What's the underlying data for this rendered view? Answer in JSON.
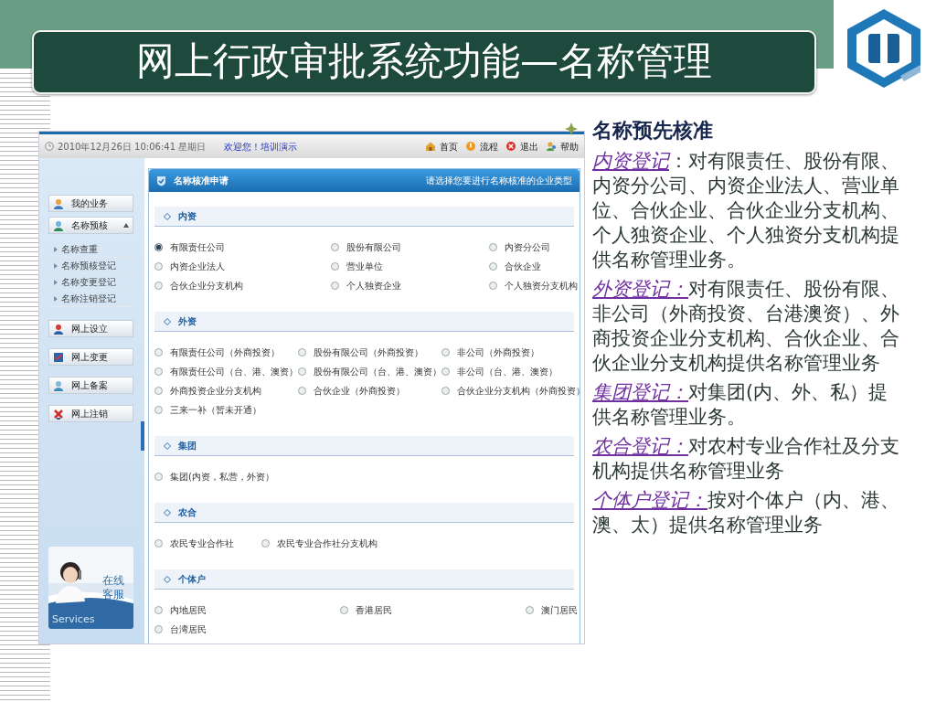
{
  "slide": {
    "title": "网上行政审批系统功能—名称管理"
  },
  "screenshot": {
    "top_bar": {
      "datetime": "2010年12月26日 10:06:41 星期日",
      "welcome": "欢迎您！培训演示",
      "links": [
        {
          "label": "首页"
        },
        {
          "label": "流程"
        },
        {
          "label": "退出"
        },
        {
          "label": "帮助"
        }
      ]
    },
    "sidebar": {
      "items": [
        {
          "label": "我的业务"
        },
        {
          "label": "名称预核",
          "expanded": true,
          "children": [
            {
              "label": "名称查重"
            },
            {
              "label": "名称预核登记"
            },
            {
              "label": "名称变更登记"
            },
            {
              "label": "名称注销登记"
            }
          ]
        },
        {
          "label": "网上设立"
        },
        {
          "label": "网上变更"
        },
        {
          "label": "网上备案"
        },
        {
          "label": "网上注销"
        }
      ],
      "service": {
        "label": "在线客服",
        "caption": "Services"
      }
    },
    "panel": {
      "title": "名称核准申请",
      "hint": "请选择您要进行名称核准的企业类型",
      "sections": [
        {
          "title": "内资",
          "options": [
            {
              "label": "有限责任公司",
              "selected": true
            },
            {
              "label": "股份有限公司",
              "selected": false
            },
            {
              "label": "内资分公司",
              "selected": false
            },
            {
              "label": "内资企业法人",
              "selected": false
            },
            {
              "label": "营业单位",
              "selected": false
            },
            {
              "label": "合伙企业",
              "selected": false
            },
            {
              "label": "合伙企业分支机构",
              "selected": false
            },
            {
              "label": "个人独资企业",
              "selected": false
            },
            {
              "label": "个人独资分支机构",
              "selected": false
            }
          ]
        },
        {
          "title": "外资",
          "options": [
            {
              "label": "有限责任公司（外商投资）",
              "selected": false
            },
            {
              "label": "股份有限公司（外商投资）",
              "selected": false
            },
            {
              "label": "非公司（外商投资）",
              "selected": false
            },
            {
              "label": "有限责任公司（台、港、澳资）",
              "selected": false
            },
            {
              "label": "股份有限公司（台、港、澳资）",
              "selected": false
            },
            {
              "label": "非公司（台、港、澳资）",
              "selected": false
            },
            {
              "label": "外商投资企业分支机构",
              "selected": false
            },
            {
              "label": "合伙企业（外商投资）",
              "selected": false
            },
            {
              "label": "合伙企业分支机构（外商投资）",
              "selected": false
            },
            {
              "label": "三来一补（暂未开通）",
              "selected": false
            }
          ]
        },
        {
          "title": "集团",
          "options": [
            {
              "label": "集团(内资，私营，外资）",
              "selected": false
            }
          ]
        },
        {
          "title": "农合",
          "options": [
            {
              "label": "农民专业合作社",
              "selected": false
            },
            {
              "label": "农民专业合作社分支机构",
              "selected": false
            }
          ]
        },
        {
          "title": "个体户",
          "options": [
            {
              "label": "内地居民",
              "selected": false
            },
            {
              "label": "香港居民",
              "selected": false
            },
            {
              "label": "澳门居民",
              "selected": false
            },
            {
              "label": "台湾居民",
              "selected": false
            }
          ]
        }
      ]
    }
  },
  "notes": {
    "heading": "名称预先核准",
    "paragraphs": [
      {
        "term": "内资登记",
        "text": "：对有限责任、股份有限、内资分公司、内资企业法人、营业单位、合伙企业、合伙企业分支机构、个人独资企业、个人独资分支机构提供名称管理业务。"
      },
      {
        "term": "外资登记：",
        "text": "对有限责任、股份有限、非公司（外商投资、台港澳资）、外商投资企业分支机构、合伙企业、合伙企业分支机构提供名称管理业务"
      },
      {
        "term": "集团登记：",
        "text": "对集团(内、外、私）提供名称管理业务。"
      },
      {
        "term": "农合登记：",
        "text": "对农村专业合作社及分支机构提供名称管理业务"
      },
      {
        "term": "个体户登记：",
        "text": "按对个体户（内、港、澳、太）提供名称管理业务"
      }
    ]
  }
}
